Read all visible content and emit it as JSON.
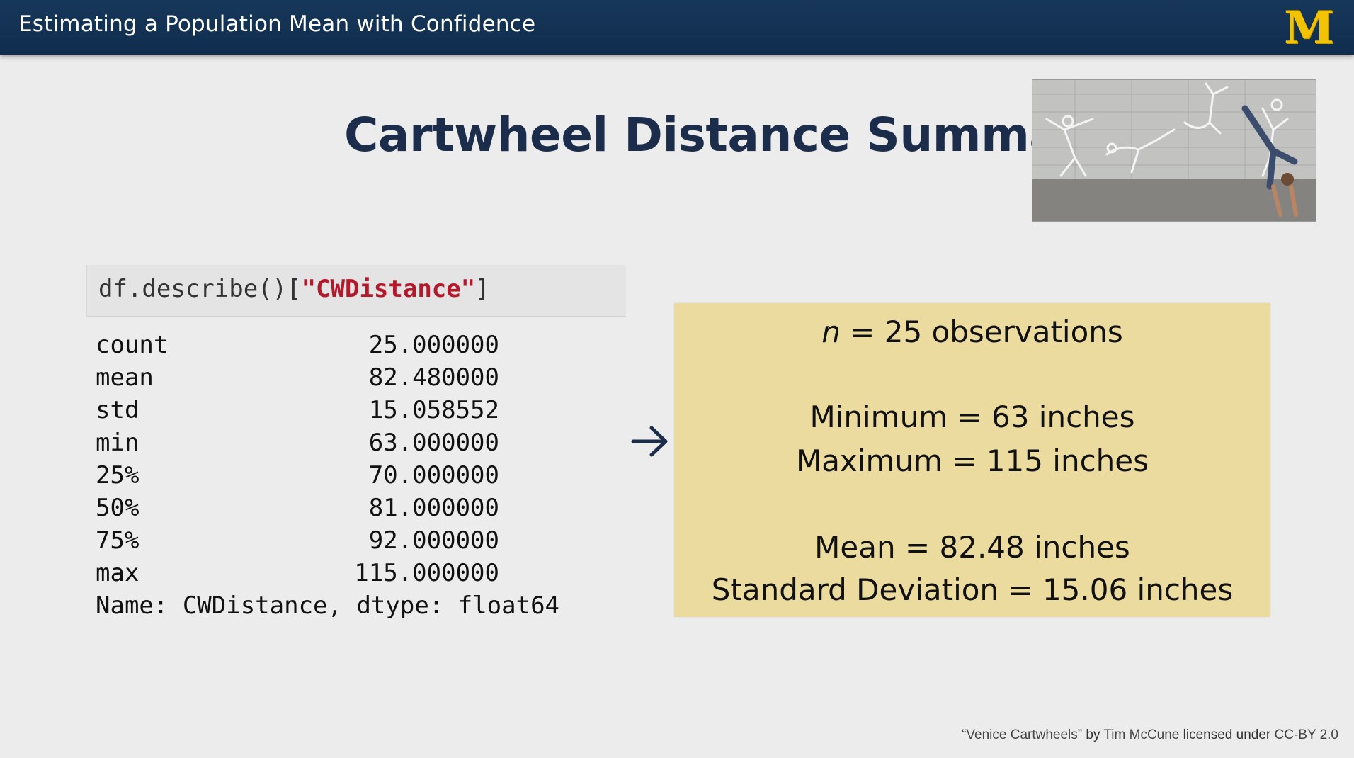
{
  "header": {
    "title": "Estimating a Population Mean with Confidence",
    "logo": "M"
  },
  "slide": {
    "title": "Cartwheel Distance Summary"
  },
  "code_cell": {
    "prefix": "df.describe()[",
    "string_arg": "\"CWDistance\"",
    "suffix": "]"
  },
  "describe_output": {
    "rows": [
      {
        "stat": "count",
        "value": "25.000000"
      },
      {
        "stat": "mean",
        "value": "82.480000"
      },
      {
        "stat": "std",
        "value": "15.058552"
      },
      {
        "stat": "min",
        "value": "63.000000"
      },
      {
        "stat": "25%",
        "value": "70.000000"
      },
      {
        "stat": "50%",
        "value": "81.000000"
      },
      {
        "stat": "75%",
        "value": "92.000000"
      },
      {
        "stat": "max",
        "value": "115.000000"
      }
    ],
    "footer": "Name: CWDistance, dtype: float64"
  },
  "summary": {
    "n_symbol": "n",
    "n_text": " = 25 observations",
    "minimum": "Minimum = 63 inches",
    "maximum": "Maximum = 115 inches",
    "mean": "Mean = 82.48 inches",
    "sd": "Standard Deviation = 15.06 inches"
  },
  "credit": {
    "quote_open": "“",
    "work_title": "Venice Cartwheels",
    "quote_close": "” by ",
    "author": "Tim McCune",
    "licensed": " licensed under ",
    "license": "CC-BY 2.0"
  },
  "colors": {
    "header_bg": "#0f2d4e",
    "logo": "#f3c200",
    "title": "#1b2d4a",
    "summary_bg": "#ecdb9f",
    "code_string": "#b5172b"
  },
  "icons": {
    "arrow": "arrow-right-icon",
    "photo": "cartwheel-photo"
  }
}
